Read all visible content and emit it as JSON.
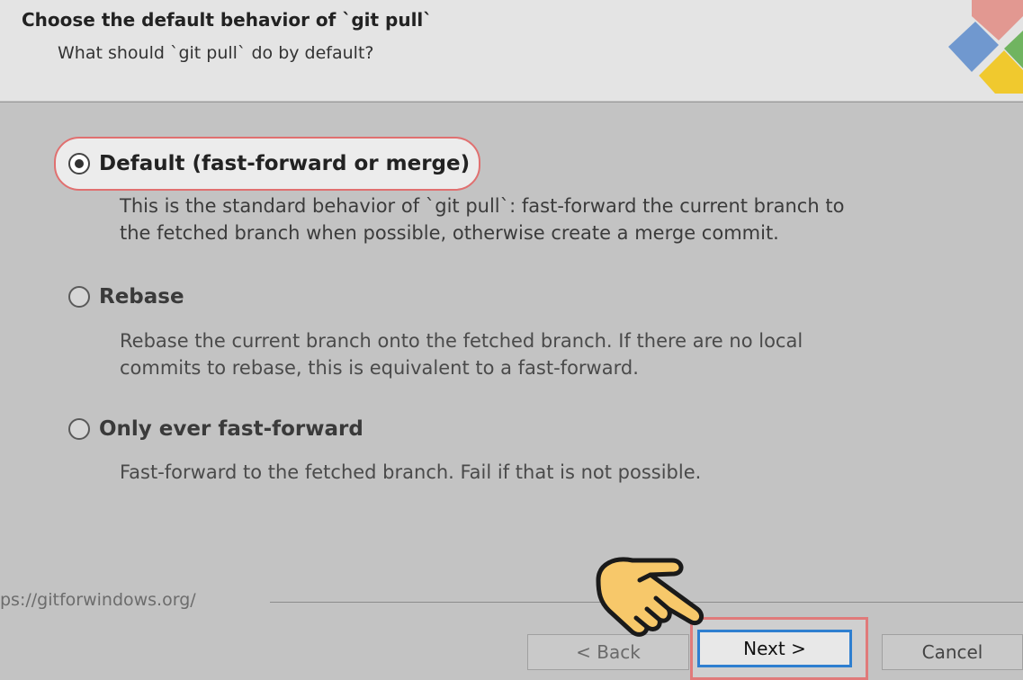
{
  "header": {
    "title": "Choose the default behavior of `git pull`",
    "subtitle": "What should `git pull` do by default?"
  },
  "options": [
    {
      "label": "Default (fast-forward or merge)",
      "selected": true,
      "description_lines": [
        "This is the standard behavior of `git pull`: fast-forward the current branch to",
        "the fetched branch when possible, otherwise create a merge commit."
      ]
    },
    {
      "label": "Rebase",
      "selected": false,
      "description_lines": [
        "Rebase the current branch onto the fetched branch. If there are no local",
        "commits to rebase, this is equivalent to a fast-forward."
      ]
    },
    {
      "label": "Only ever fast-forward",
      "selected": false,
      "description_lines": [
        "Fast-forward to the fetched branch. Fail if that is not possible."
      ]
    }
  ],
  "footer": {
    "url": "ps://gitforwindows.org/",
    "back_label": "< Back",
    "next_label": "Next >",
    "cancel_label": "Cancel"
  },
  "icons": {
    "logo": "git-logo-icon",
    "pointer": "pointing-hand-icon"
  },
  "colors": {
    "highlight_border": "#e07070",
    "next_focus_border": "#2f7fd0",
    "header_bg": "#e4e4e4",
    "body_bg": "#c3c3c3"
  }
}
